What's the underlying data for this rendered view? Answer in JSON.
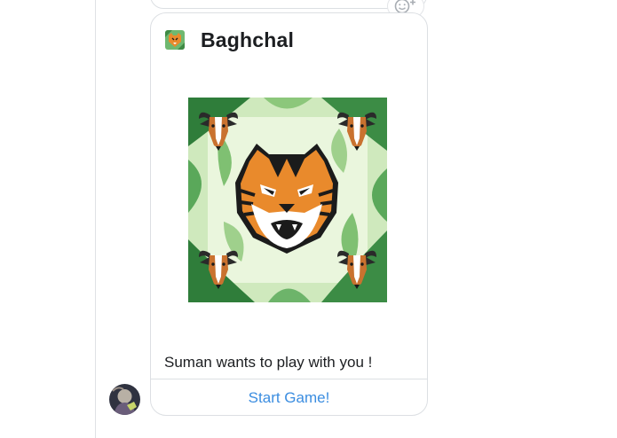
{
  "game_card": {
    "title": "Baghchal",
    "message": "Suman wants to play with you !",
    "start_button_label": "Start Game!",
    "app_icon": "tiger-icon",
    "image": "baghchal-tiger-goats-jungle-art"
  },
  "reaction_button": {
    "icon": "add-emoji-icon"
  },
  "sender": {
    "avatar": "user-avatar"
  },
  "colors": {
    "link_blue": "#3b8de0",
    "text": "#1c1e21",
    "border": "#dcdfe3",
    "jungle_green": "#4c9a4e",
    "tiger_orange": "#e98a2c"
  }
}
